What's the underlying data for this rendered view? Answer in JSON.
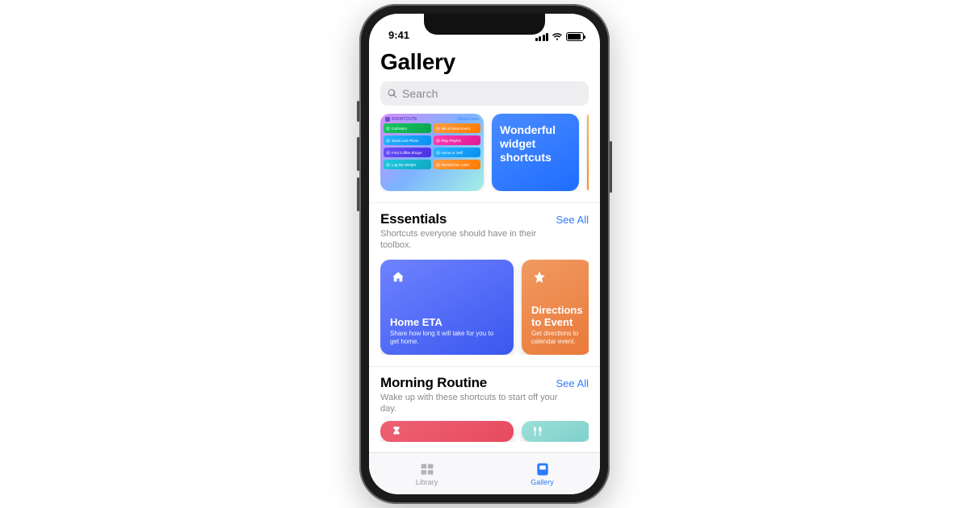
{
  "status": {
    "time": "9:41"
  },
  "page": {
    "title": "Gallery"
  },
  "search": {
    "placeholder": "Search"
  },
  "hero": {
    "widgets_header": "SHORTCUTS",
    "widgets_more": "Show Less",
    "widget_items": [
      "Call Mom",
      "Min to Next Event",
      "Send Last Photo",
      "Play Playlist",
      "Find Coffee Shops",
      "Home or Self",
      "Log My Weight",
      "Remind Me Later"
    ],
    "featured_title": "Wonderful widget shortcuts"
  },
  "sections": {
    "essentials": {
      "title": "Essentials",
      "see_all": "See All",
      "subtitle": "Shortcuts everyone should have in their toolbox.",
      "cards": [
        {
          "title": "Home ETA",
          "desc": "Share how long it will take for you to get home."
        },
        {
          "title": "Directions to Event",
          "desc": "Get directions to calendar event."
        }
      ]
    },
    "morning": {
      "title": "Morning Routine",
      "see_all": "See All",
      "subtitle": "Wake up with these shortcuts to start off your day."
    }
  },
  "tabbar": {
    "library": "Library",
    "gallery": "Gallery"
  }
}
